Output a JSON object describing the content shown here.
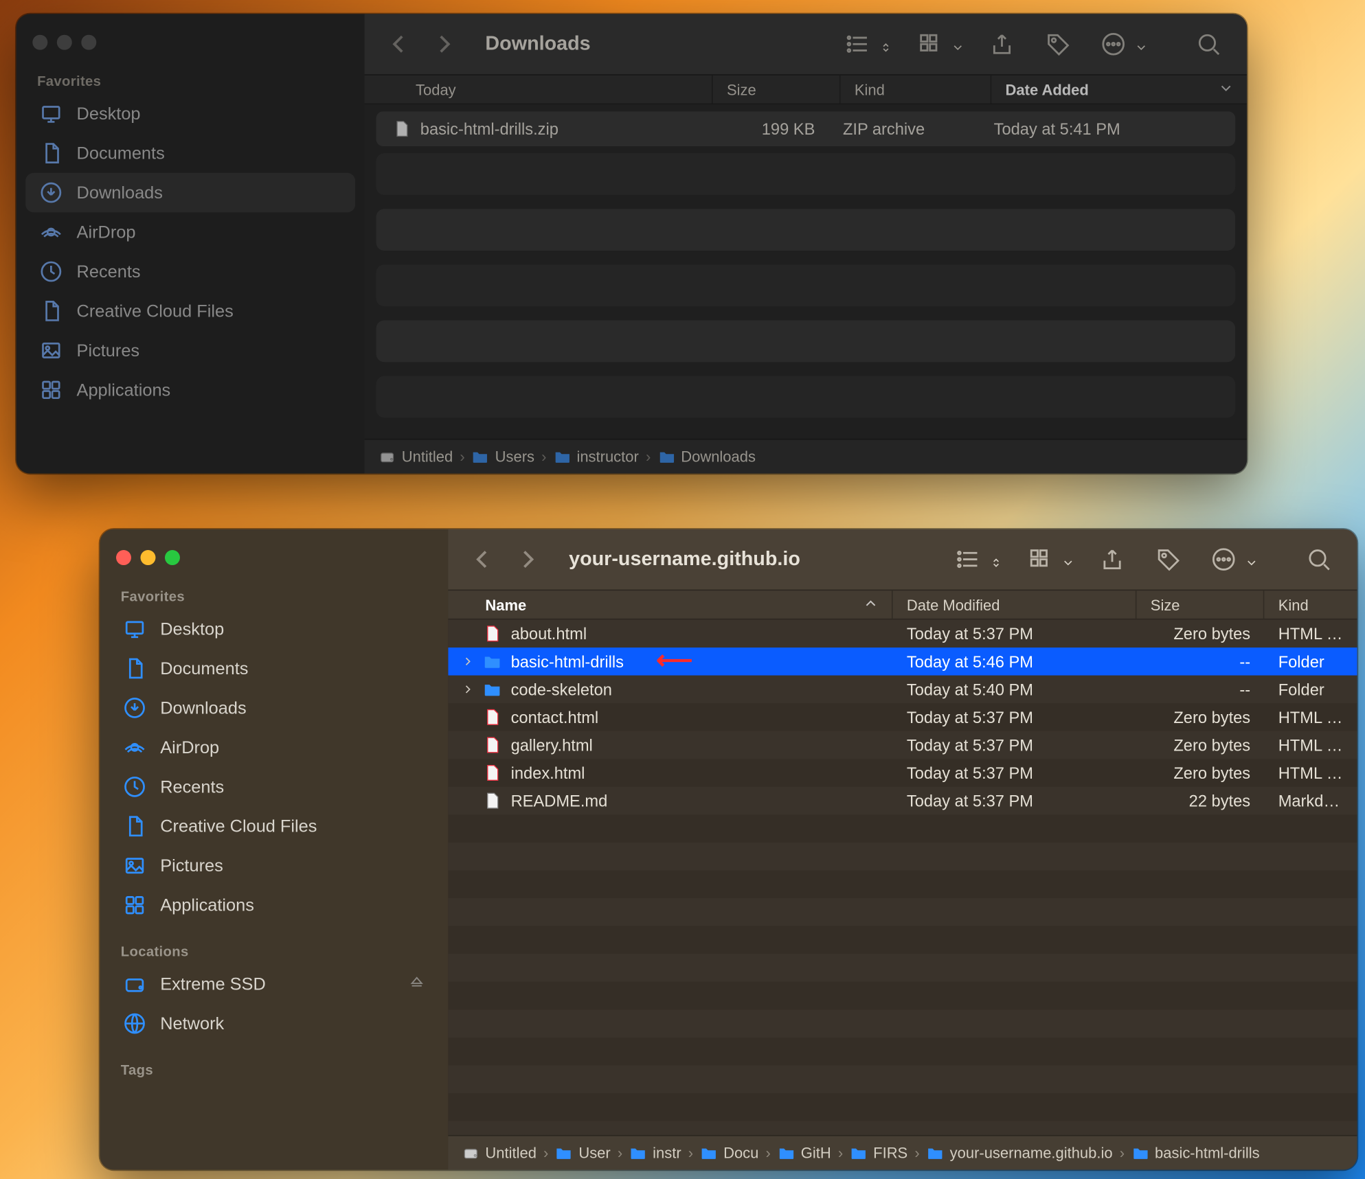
{
  "back": {
    "title": "Downloads",
    "sidebar": {
      "favorites_label": "Favorites",
      "items": [
        {
          "label": "Desktop",
          "icon": "desktop"
        },
        {
          "label": "Documents",
          "icon": "doc"
        },
        {
          "label": "Downloads",
          "icon": "download",
          "active": true
        },
        {
          "label": "AirDrop",
          "icon": "airdrop"
        },
        {
          "label": "Recents",
          "icon": "clock"
        },
        {
          "label": "Creative Cloud Files",
          "icon": "doc"
        },
        {
          "label": "Pictures",
          "icon": "image"
        },
        {
          "label": "Applications",
          "icon": "apps"
        }
      ]
    },
    "columns": {
      "name": "Today",
      "size": "Size",
      "kind": "Kind",
      "date": "Date Added"
    },
    "rows": [
      {
        "name": "basic-html-drills.zip",
        "size": "199 KB",
        "kind": "ZIP archive",
        "date": "Today at 5:41 PM",
        "icon": "zip"
      }
    ],
    "path": [
      {
        "label": "Untitled",
        "icon": "disk"
      },
      {
        "label": "Users",
        "icon": "folder"
      },
      {
        "label": "instructor",
        "icon": "folder"
      },
      {
        "label": "Downloads",
        "icon": "folder"
      }
    ]
  },
  "front": {
    "title": "your-username.github.io",
    "sidebar": {
      "favorites_label": "Favorites",
      "locations_label": "Locations",
      "tags_label": "Tags",
      "items": [
        {
          "label": "Desktop",
          "icon": "desktop"
        },
        {
          "label": "Documents",
          "icon": "doc"
        },
        {
          "label": "Downloads",
          "icon": "download"
        },
        {
          "label": "AirDrop",
          "icon": "airdrop"
        },
        {
          "label": "Recents",
          "icon": "clock"
        },
        {
          "label": "Creative Cloud Files",
          "icon": "doc"
        },
        {
          "label": "Pictures",
          "icon": "image"
        },
        {
          "label": "Applications",
          "icon": "apps"
        }
      ],
      "locations": [
        {
          "label": "Extreme SSD",
          "icon": "disk",
          "eject": true
        },
        {
          "label": "Network",
          "icon": "globe"
        }
      ]
    },
    "columns": {
      "name": "Name",
      "date": "Date Modified",
      "size": "Size",
      "kind": "Kind"
    },
    "rows": [
      {
        "name": "about.html",
        "date": "Today at 5:37 PM",
        "size": "Zero bytes",
        "kind": "HTML tex",
        "icon": "html"
      },
      {
        "name": "basic-html-drills",
        "date": "Today at 5:46 PM",
        "size": "--",
        "kind": "Folder",
        "icon": "folder",
        "selected": true,
        "disclosure": true,
        "annotate": true
      },
      {
        "name": "code-skeleton",
        "date": "Today at 5:40 PM",
        "size": "--",
        "kind": "Folder",
        "icon": "folder",
        "disclosure": true
      },
      {
        "name": "contact.html",
        "date": "Today at 5:37 PM",
        "size": "Zero bytes",
        "kind": "HTML tex",
        "icon": "html"
      },
      {
        "name": "gallery.html",
        "date": "Today at 5:37 PM",
        "size": "Zero bytes",
        "kind": "HTML tex",
        "icon": "html"
      },
      {
        "name": "index.html",
        "date": "Today at 5:37 PM",
        "size": "Zero bytes",
        "kind": "HTML tex",
        "icon": "html"
      },
      {
        "name": "README.md",
        "date": "Today at 5:37 PM",
        "size": "22 bytes",
        "kind": "Markdow",
        "icon": "md"
      }
    ],
    "path": [
      {
        "label": "Untitled",
        "icon": "disk"
      },
      {
        "label": "User",
        "icon": "folder"
      },
      {
        "label": "instr",
        "icon": "folder"
      },
      {
        "label": "Docu",
        "icon": "folder"
      },
      {
        "label": "GitH",
        "icon": "folder"
      },
      {
        "label": "FIRS",
        "icon": "folder"
      },
      {
        "label": "your-username.github.io",
        "icon": "folder"
      },
      {
        "label": "basic-html-drills",
        "icon": "folder"
      }
    ]
  }
}
